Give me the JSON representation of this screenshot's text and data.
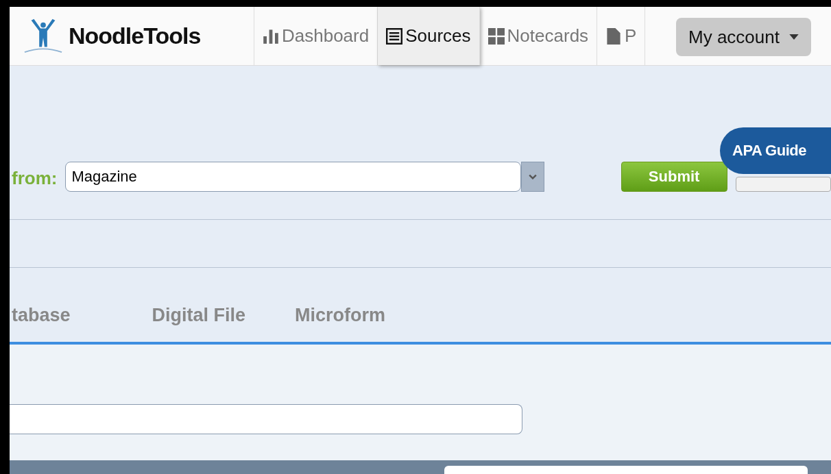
{
  "logo": {
    "text": "NoodleTools"
  },
  "nav": [
    {
      "label": "Dashboard",
      "kind": "chart",
      "selected": false
    },
    {
      "label": "Sources",
      "kind": "list",
      "selected": true
    },
    {
      "label": "Notecards",
      "kind": "grid",
      "selected": false
    },
    {
      "label": "P",
      "kind": "doc",
      "selected": false
    }
  ],
  "account": {
    "label": "My account"
  },
  "apa_guide": {
    "label": "APA Guide"
  },
  "source_type": {
    "label": "from:",
    "value": "Magazine"
  },
  "buttons": {
    "submit": "Submit"
  },
  "medium_tabs": [
    "tabase",
    "Digital File",
    "Microform"
  ]
}
